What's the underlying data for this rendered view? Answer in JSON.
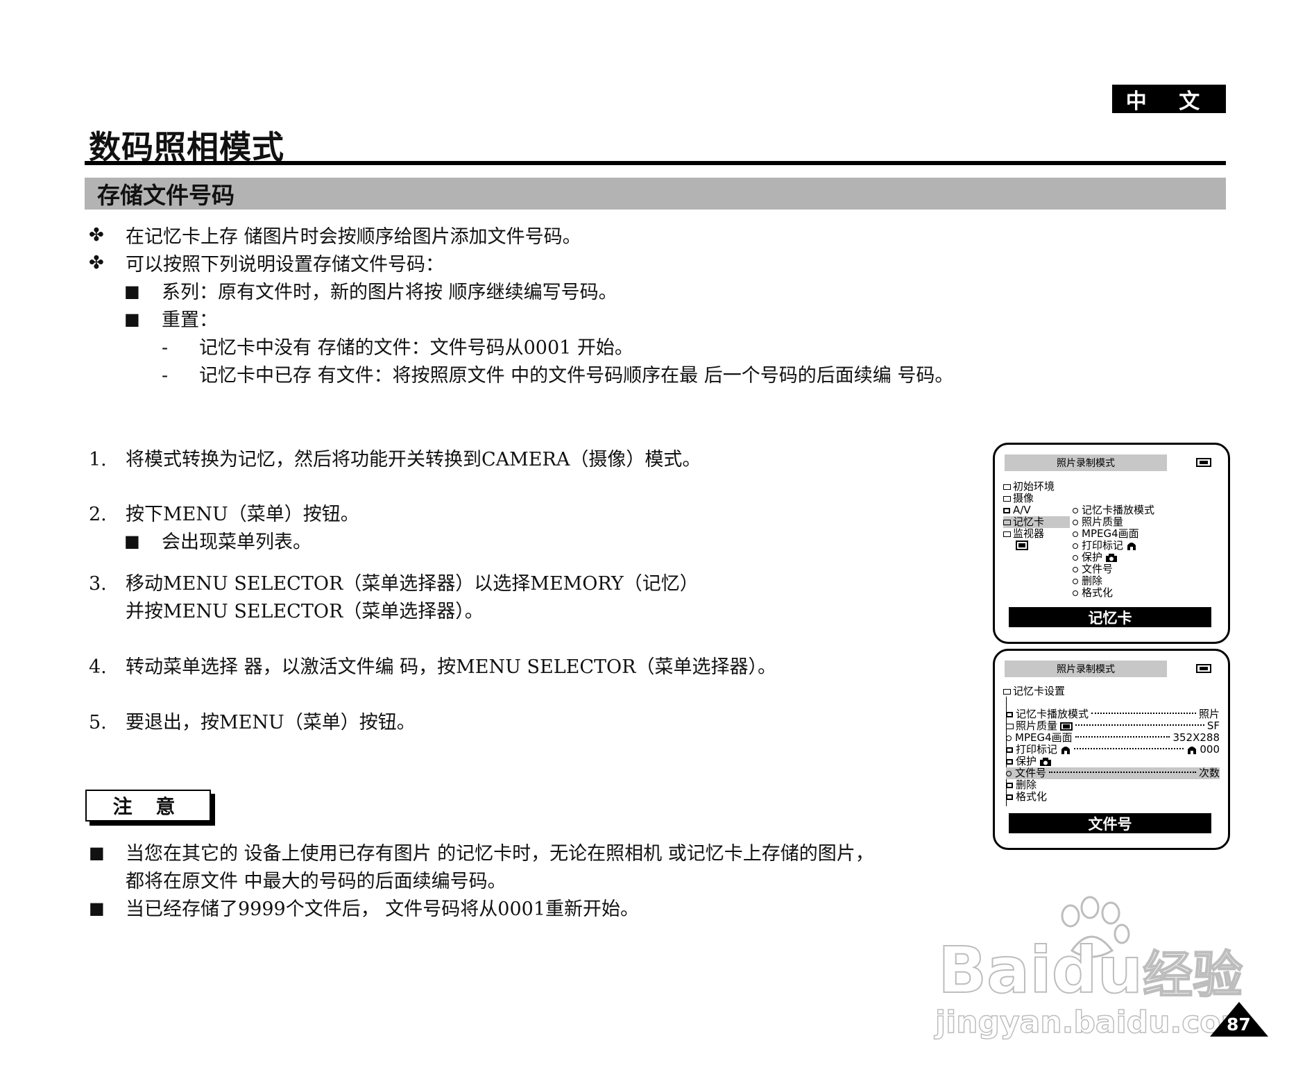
{
  "header": {
    "lang_tab": "中 文",
    "page_title": "数码照相模式",
    "section_title": "存储文件号码"
  },
  "intro": {
    "bullet_mark": "✤",
    "bullets": [
      "在记忆卡上存 储图片时会按顺序给图片添加文件号码。",
      "可以按照下列说明设置存储文件号码："
    ],
    "square_mark": "■",
    "sub_items": [
      "系列：原有文件时，新的图片将按 顺序继续编写号码。",
      "重置："
    ],
    "dash_mark": "-",
    "dash_items": [
      "记忆卡中没有 存储的文件：文件号码从0001 开始。",
      "记忆卡中已存 有文件：将按照原文件 中的文件号码顺序在最 后一个号码的后面续编 号码。"
    ]
  },
  "steps": [
    {
      "num": "1.",
      "text": "将模式转换为记忆，然后将功能开关转换到CAMERA（摄像）模式。"
    },
    {
      "num": "2.",
      "text": "按下MENU（菜单）按钮。",
      "sub": "会出现菜单列表。"
    },
    {
      "num": "3.",
      "text": "移动MENU SELECTOR（菜单选择器）以选择MEMORY（记忆）",
      "text2": "并按MENU SELECTOR（菜单选择器）。"
    },
    {
      "num": "4.",
      "text": "转动菜单选择 器，以激活文件编 码，按MENU SELECTOR（菜单选择器）。"
    },
    {
      "num": "5.",
      "text": "要退出，按MENU（菜单）按钮。"
    }
  ],
  "note": {
    "label": "注 意",
    "items": [
      {
        "line1": "当您在其它的 设备上使用已存有图片 的记忆卡时，无论在照相机 或记忆卡上存储的图片，",
        "line2": "都将在原文件 中最大的号码的后面续编号码。"
      },
      {
        "line1": "当已经存储了9999个文件后， 文件号码将从0001重新开始。"
      }
    ]
  },
  "screen1": {
    "header": "照片录制模式",
    "left_menu": [
      "初始环境",
      "摄像",
      "A/V",
      "记忆卡",
      "监视器"
    ],
    "right_menu": [
      "记忆卡播放模式",
      "照片质量",
      "MPEG4画面",
      "打印标记",
      "保护",
      "文件号",
      "删除",
      "格式化"
    ],
    "footer": "记忆卡"
  },
  "screen2": {
    "header": "照片录制模式",
    "group": "记忆卡设置",
    "rows": [
      {
        "label": "记忆卡播放模式",
        "value": "照片"
      },
      {
        "label": "照片质量",
        "value": "SF"
      },
      {
        "label": "MPEG4画面",
        "value": "352X288"
      },
      {
        "label": "打印标记",
        "value": "000"
      },
      {
        "label": "保护",
        "value": ""
      },
      {
        "label": "文件号",
        "value": "次数"
      },
      {
        "label": "删除",
        "value": ""
      },
      {
        "label": "格式化",
        "value": ""
      }
    ],
    "footer": "文件号"
  },
  "watermark": {
    "brand": "Bai",
    "brand2": "du",
    "cn": "经验",
    "url": "jingyan.baidu.com"
  },
  "page_number": "87",
  "icons": [
    "camera-icon",
    "folder-icon",
    "print-mark-icon",
    "protect-icon",
    "paw-icon"
  ]
}
